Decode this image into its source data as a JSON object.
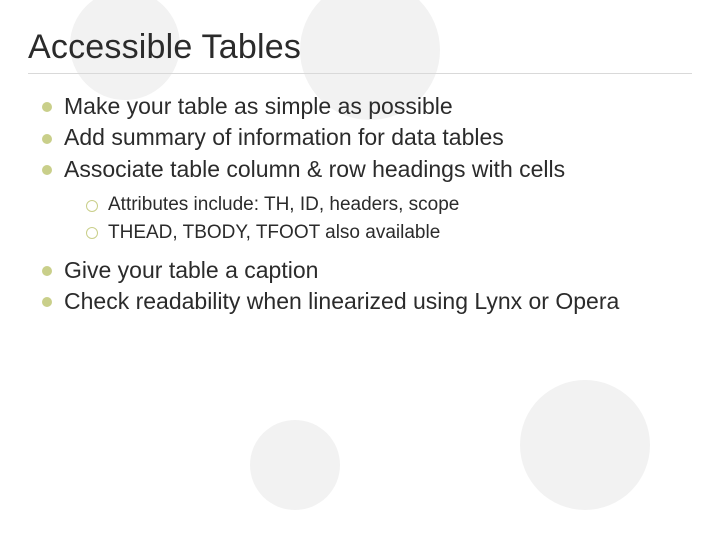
{
  "title": "Accessible Tables",
  "bullets": {
    "b1": "Make your table as simple as possible",
    "b2": "Add summary of information for data tables",
    "b3": "Associate table column & row headings with cells",
    "b4": "Give your table a caption",
    "b5": "Check readability when linearized using Lynx or Opera"
  },
  "sub": {
    "s1": "Attributes include: TH, ID, headers, scope",
    "s2": "THEAD, TBODY, TFOOT also available"
  }
}
